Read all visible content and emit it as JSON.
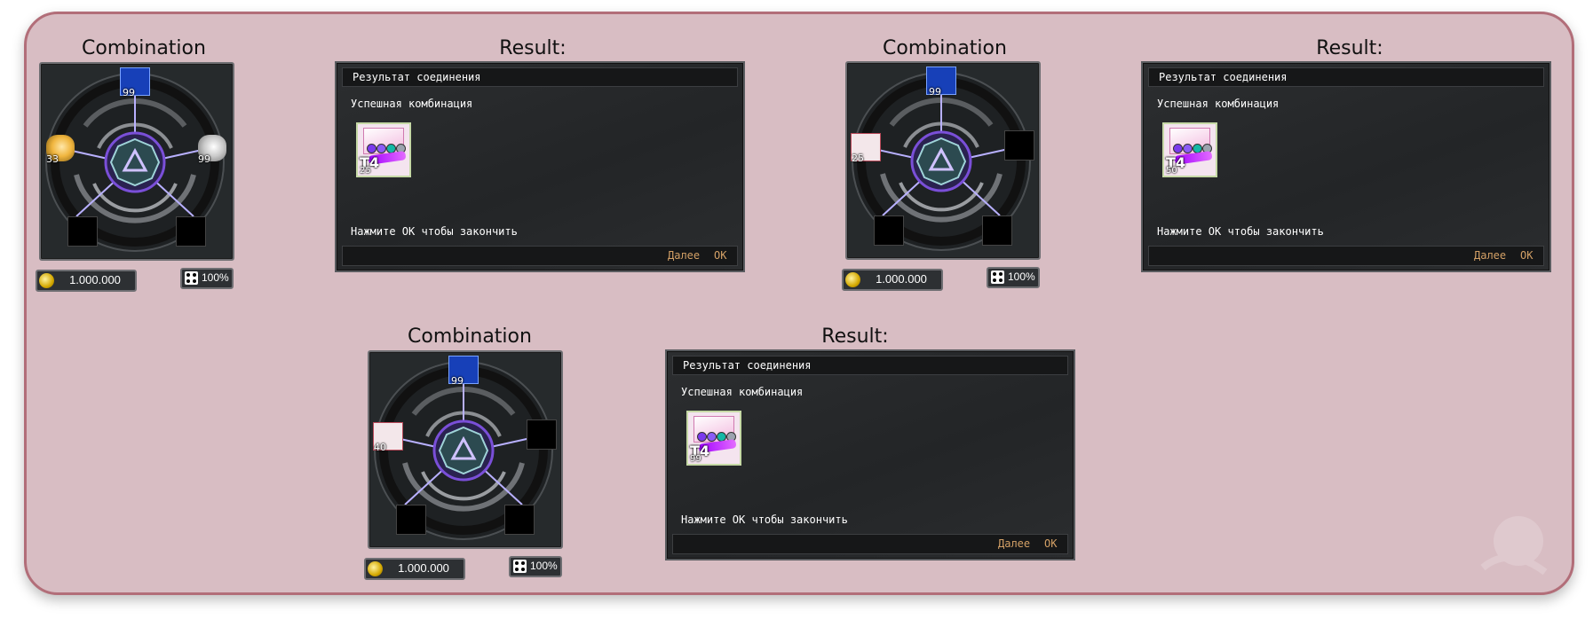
{
  "panels": [
    {
      "combination_heading": "Combination",
      "result_heading": "Result:",
      "slots": {
        "top": {
          "type": "mana",
          "count": "99"
        },
        "left": {
          "type": "shell-gold",
          "count": "33"
        },
        "right": {
          "type": "shell-silver",
          "count": "99"
        }
      },
      "gold": "1.000.000",
      "chance": "100%",
      "result_title": "Результат соединения",
      "result_status": "Успешная комбинация",
      "reward_tier": "T4",
      "reward_qty": "25",
      "hint": "Нажмите ОК чтобы закончить",
      "next_label": "Далее",
      "ok_label": "ОК"
    },
    {
      "combination_heading": "Combination",
      "result_heading": "Result:",
      "slots": {
        "top": {
          "type": "mana",
          "count": "99"
        },
        "left": {
          "type": "scroll",
          "count": "25"
        }
      },
      "gold": "1.000.000",
      "chance": "100%",
      "result_title": "Результат соединения",
      "result_status": "Успешная комбинация",
      "reward_tier": "T4",
      "reward_qty": "50",
      "hint": "Нажмите ОК чтобы закончить",
      "next_label": "Далее",
      "ok_label": "ОК"
    },
    {
      "combination_heading": "Combination",
      "result_heading": "Result:",
      "slots": {
        "top": {
          "type": "mana",
          "count": "99"
        },
        "left": {
          "type": "scroll",
          "count": "40"
        }
      },
      "gold": "1.000.000",
      "chance": "100%",
      "result_title": "Результат соединения",
      "result_status": "Успешная комбинация",
      "reward_tier": "T4",
      "reward_qty": "99",
      "hint": "Нажмите ОК чтобы закончить",
      "next_label": "Далее",
      "ok_label": "ОК"
    }
  ],
  "colors": {
    "card_bg": "#d8bdc3",
    "card_border": "#b26e79",
    "button_text": "#d3a066",
    "ring_accent": "#7a4fd8"
  }
}
